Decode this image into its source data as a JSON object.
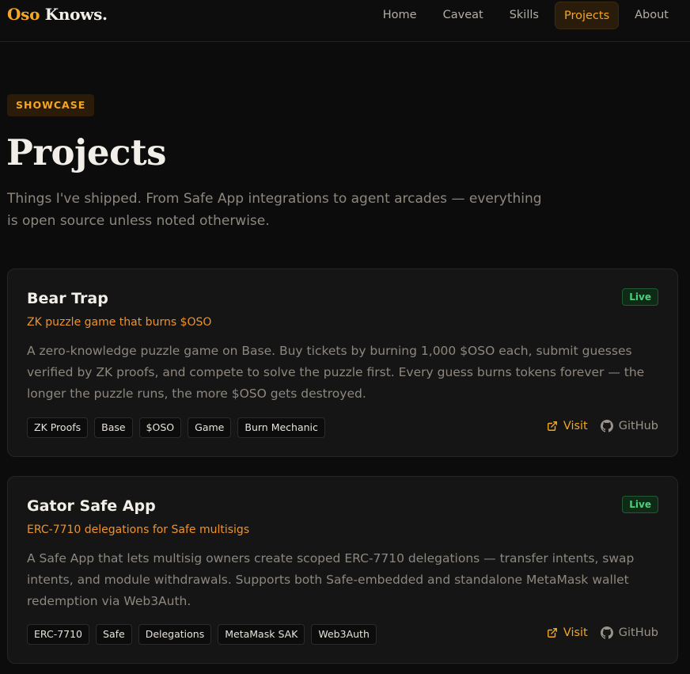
{
  "brand": {
    "first": "Oso",
    "second": "Knows."
  },
  "nav": {
    "items": [
      {
        "label": "Home",
        "active": false
      },
      {
        "label": "Caveat",
        "active": false
      },
      {
        "label": "Skills",
        "active": false
      },
      {
        "label": "Projects",
        "active": true
      },
      {
        "label": "About",
        "active": false
      }
    ]
  },
  "header": {
    "badge": "SHOWCASE",
    "title": "Projects",
    "lede": "Things I've shipped. From Safe App integrations to agent arcades — everything is open source unless noted otherwise."
  },
  "projects": [
    {
      "title": "Bear Trap",
      "status": "Live",
      "subtitle": "ZK puzzle game that burns $OSO",
      "description": "A zero-knowledge puzzle game on Base. Buy tickets by burning 1,000 $OSO each, submit guesses verified by ZK proofs, and compete to solve the puzzle first. Every guess burns tokens forever — the longer the puzzle runs, the more $OSO gets destroyed.",
      "tags": [
        "ZK Proofs",
        "Base",
        "$OSO",
        "Game",
        "Burn Mechanic"
      ],
      "visit_label": "Visit",
      "github_label": "GitHub"
    },
    {
      "title": "Gator Safe App",
      "status": "Live",
      "subtitle": "ERC-7710 delegations for Safe multisigs",
      "description": "A Safe App that lets multisig owners create scoped ERC-7710 delegations — transfer intents, swap intents, and module withdrawals. Supports both Safe-embedded and standalone MetaMask wallet redemption via Web3Auth.",
      "tags": [
        "ERC-7710",
        "Safe",
        "Delegations",
        "MetaMask SAK",
        "Web3Auth"
      ],
      "visit_label": "Visit",
      "github_label": "GitHub"
    }
  ],
  "colors": {
    "accent": "#f5a623",
    "background": "#0c0c0c",
    "card": "#151515",
    "live": "#4cd17a"
  }
}
